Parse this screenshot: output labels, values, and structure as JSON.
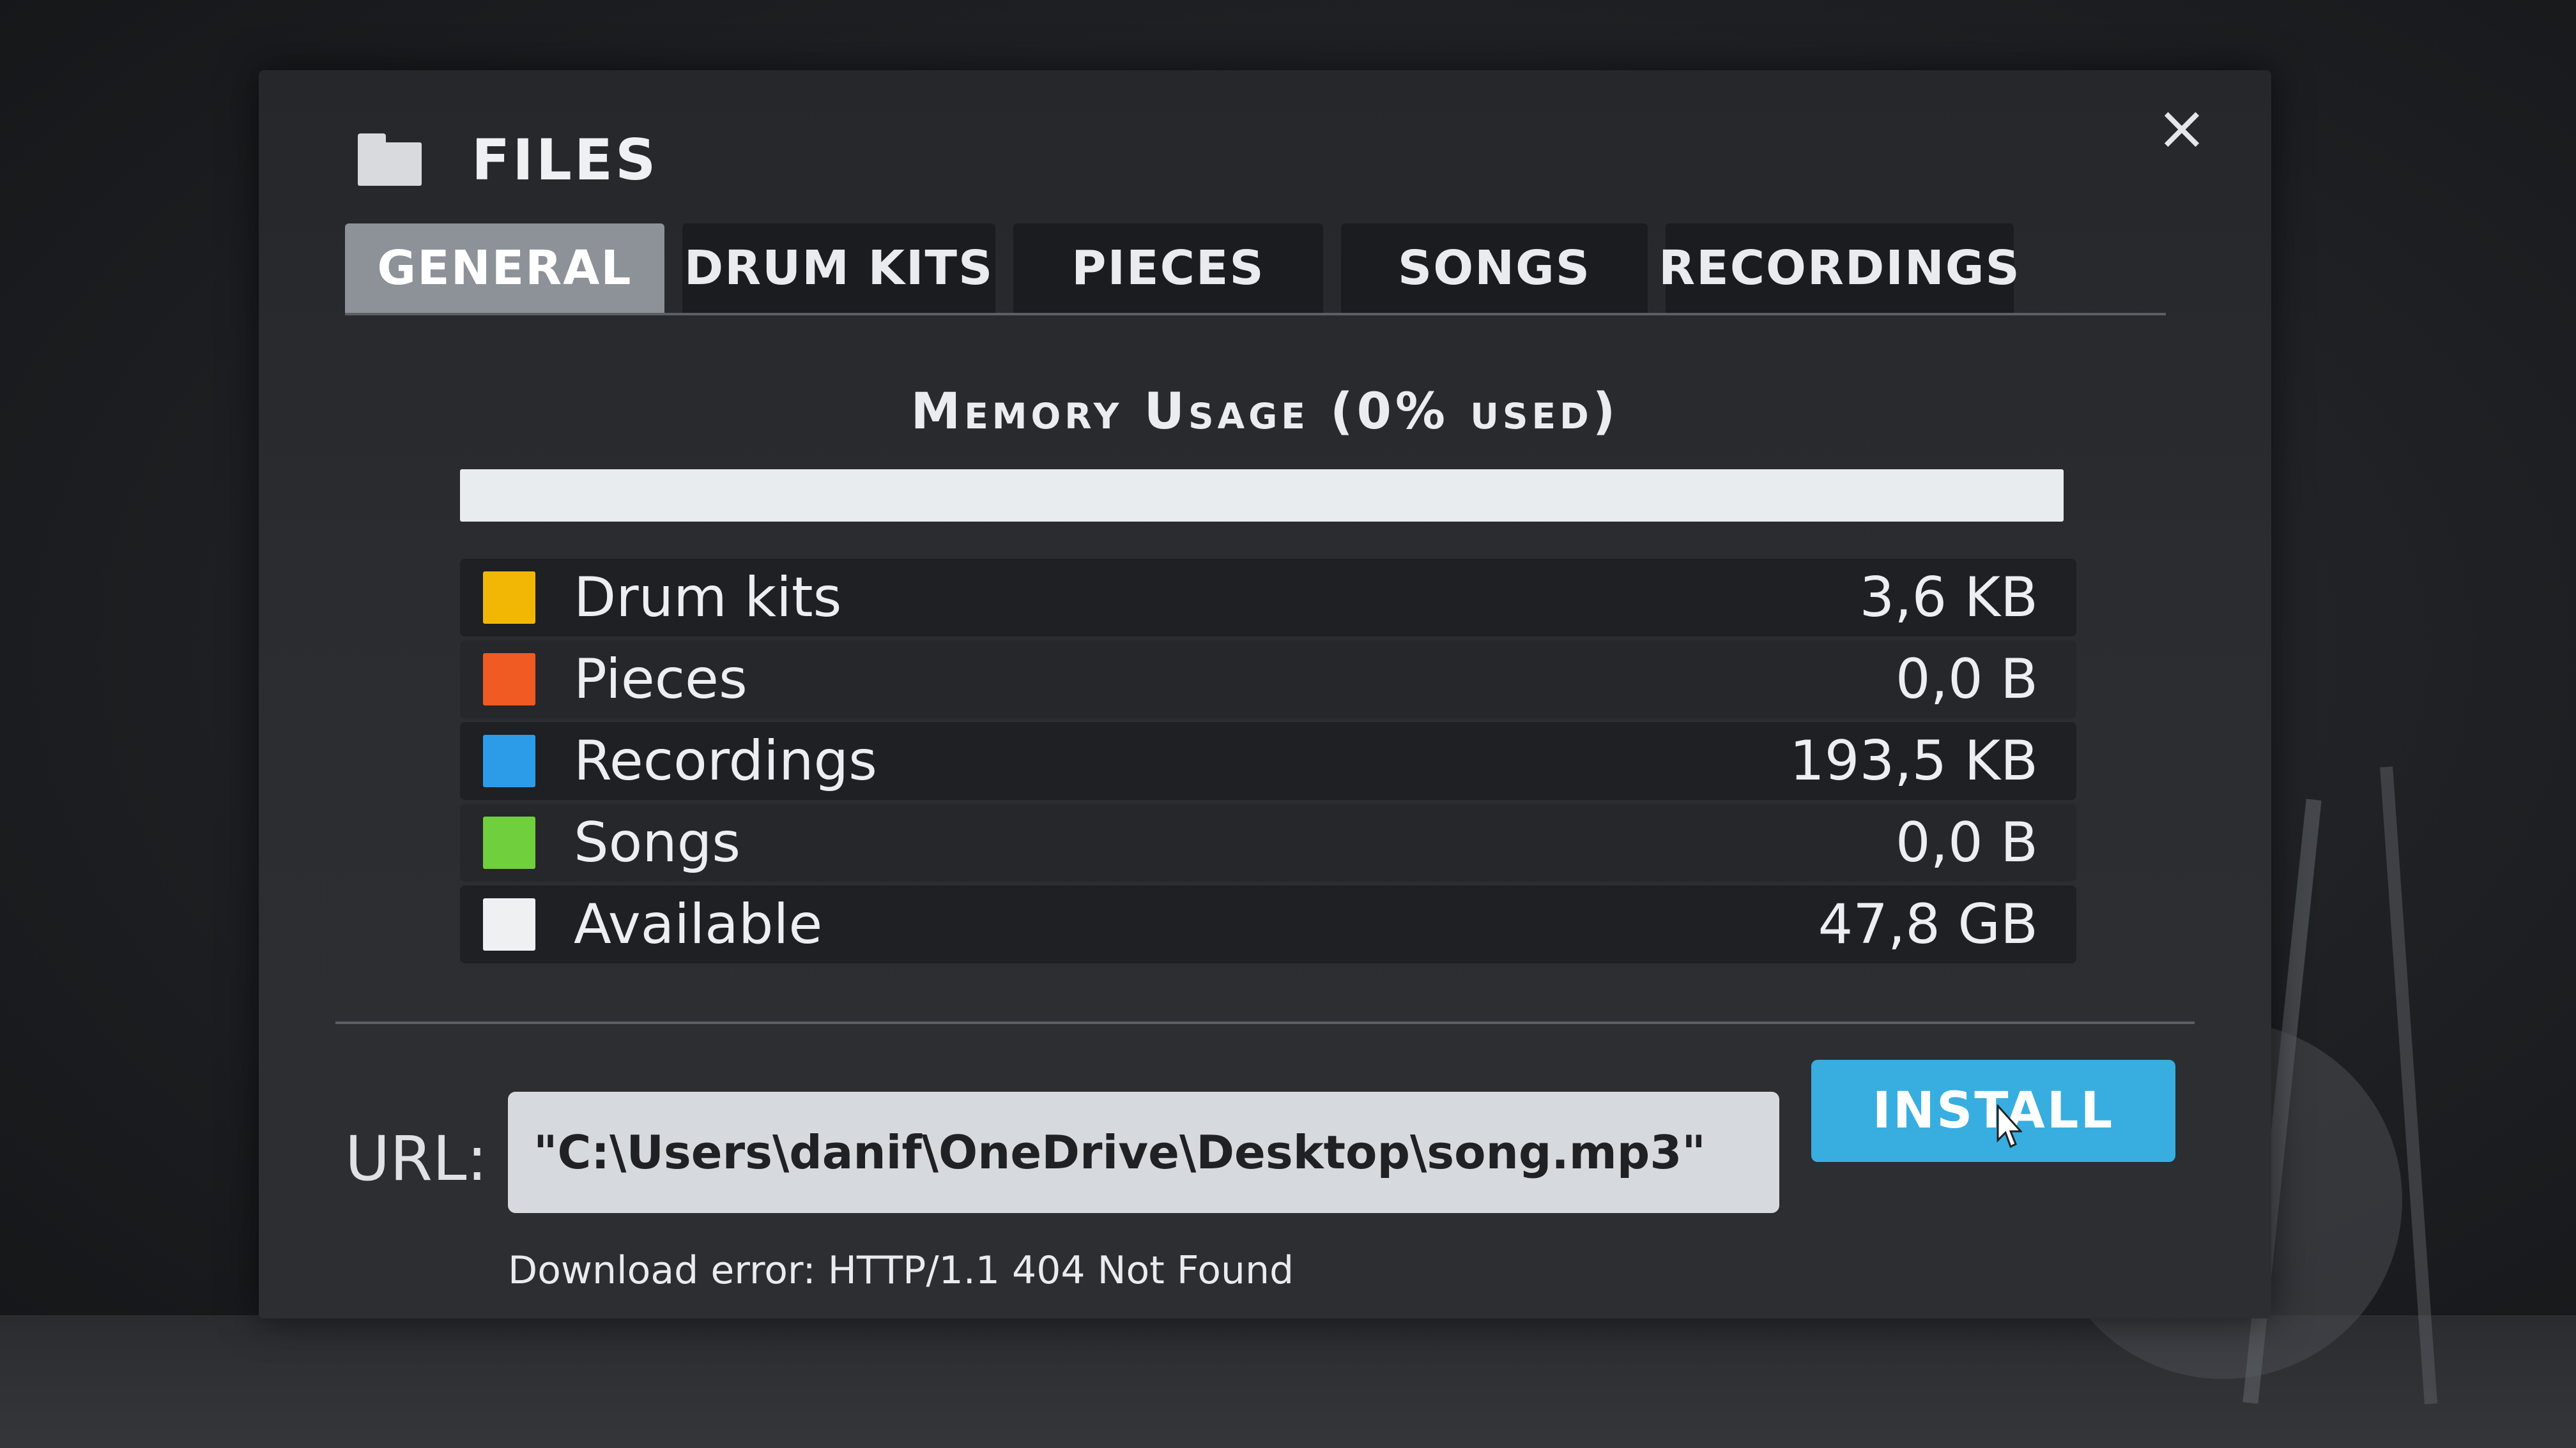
{
  "window": {
    "title": "FILES",
    "close_label": "×"
  },
  "tabs": [
    {
      "label": "GENERAL",
      "active": true
    },
    {
      "label": "DRUM KITS",
      "active": false
    },
    {
      "label": "PIECES",
      "active": false
    },
    {
      "label": "SONGS",
      "active": false
    },
    {
      "label": "RECORDINGS",
      "active": false
    }
  ],
  "memory": {
    "title": "Memory Usage (0% used)",
    "used_fraction": 0,
    "items": [
      {
        "label": "Drum kits",
        "value": "3,6 KB",
        "color": "#f2b705"
      },
      {
        "label": "Pieces",
        "value": "0,0 B",
        "color": "#f05a23"
      },
      {
        "label": "Recordings",
        "value": "193,5 KB",
        "color": "#2d9ce8"
      },
      {
        "label": "Songs",
        "value": "0,0 B",
        "color": "#6fcf3d"
      },
      {
        "label": "Available",
        "value": "47,8 GB",
        "color": "#eef0f2"
      }
    ]
  },
  "install": {
    "url_label": "URL:",
    "url_value": "\"C:\\Users\\danif\\OneDrive\\Desktop\\song.mp3\"",
    "button_label": "INSTALL",
    "error_message": "Download error: HTTP/1.1 404 Not Found"
  },
  "icons": {
    "folder": "folder-icon",
    "close": "close-icon",
    "cursor": "mouse-cursor-icon"
  }
}
